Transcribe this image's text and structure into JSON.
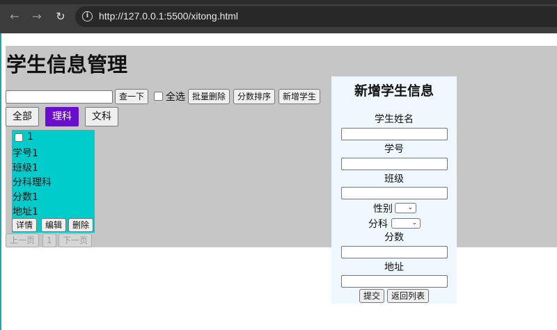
{
  "browser": {
    "back": "←",
    "forward": "→",
    "reload": "↻",
    "info": "i",
    "url": "http://127.0.0.1:5500/xitong.html"
  },
  "page": {
    "title": "学生信息管理"
  },
  "toolbar": {
    "search_placeholder": "",
    "search_btn": "查一下",
    "select_all": "全选",
    "batch_delete": "批量删除",
    "sort_score": "分数排序",
    "add_student": "新增学生"
  },
  "filters": {
    "all": "全部",
    "science": "理科",
    "arts": "文科",
    "active": "理科"
  },
  "student_card": {
    "id_text": "1",
    "student_no": "学号1",
    "class": "班级1",
    "track": "分科理科",
    "score": "分数1",
    "address": "地址1",
    "detail_btn": "详情",
    "edit_btn": "编辑",
    "delete_btn": "删除"
  },
  "pagination": {
    "prev": "上一页",
    "page": "1",
    "next": "下一页"
  },
  "form": {
    "title": "新增学生信息",
    "name_label": "学生姓名",
    "student_no_label": "学号",
    "class_label": "班级",
    "gender_label": "性别",
    "track_label": "分科",
    "score_label": "分数",
    "address_label": "地址",
    "submit_btn": "提交",
    "back_btn": "返回列表",
    "select_arrow": "⌄"
  },
  "colors": {
    "active_filter": "#6a0dcf",
    "card_bg": "#00cccc",
    "form_bg": "#f0f8ff",
    "page_bg": "#c6c6c6"
  }
}
